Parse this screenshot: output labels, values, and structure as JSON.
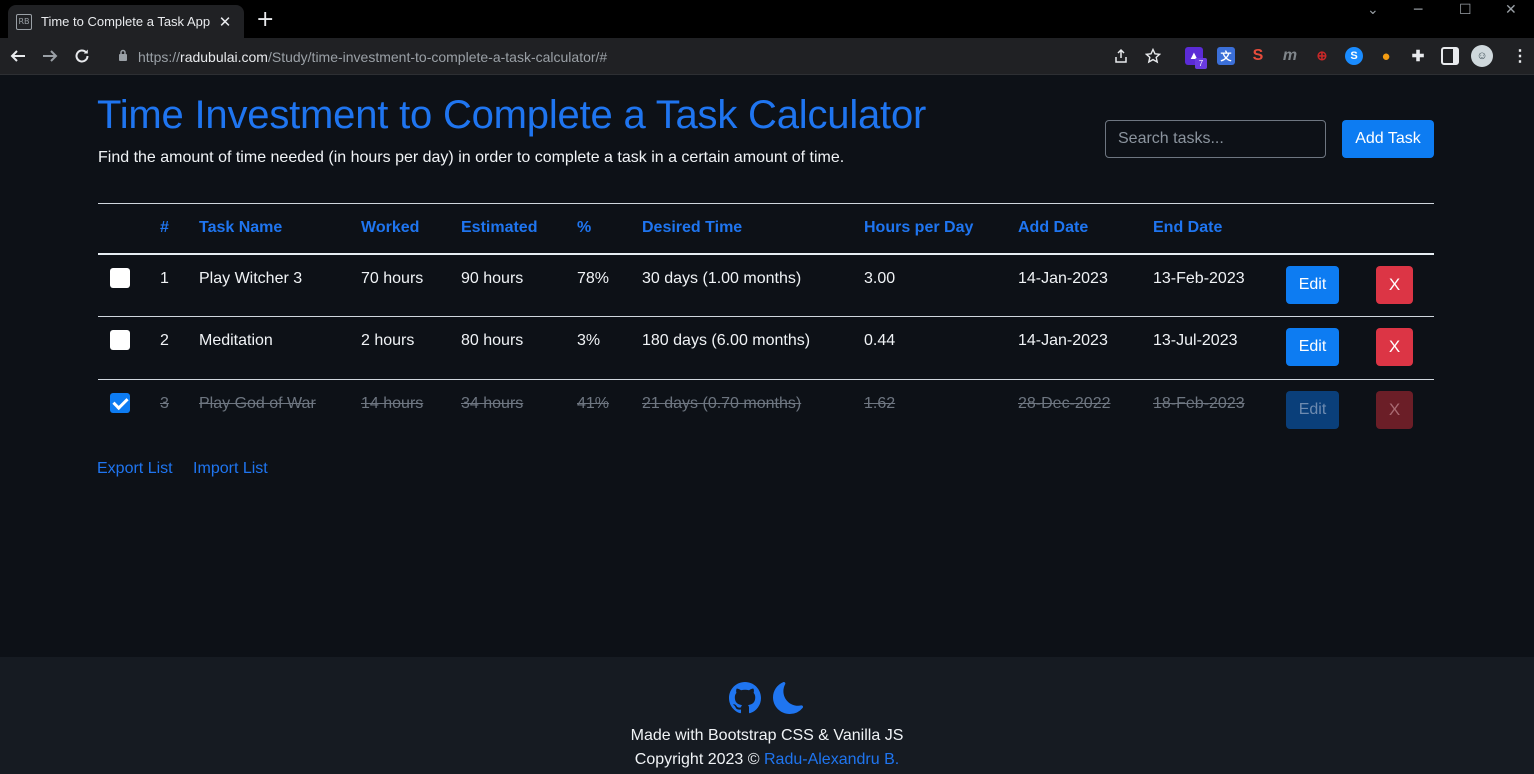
{
  "browser": {
    "tab_title": "Time to Complete a Task App",
    "tab_favicon": "RB",
    "url_prefix": "https://",
    "url_host": "radubulai.com",
    "url_path": "/Study/time-investment-to-complete-a-task-calculator/#",
    "extensions": [
      {
        "icon": "graduation-cap-icon",
        "color": "#5b2bd6",
        "badge": "7"
      },
      {
        "icon": "translate-icon",
        "color": "#3b6fd8"
      },
      {
        "icon": "s-icon",
        "color": "#c0392b"
      },
      {
        "icon": "m-icon",
        "color": "#5f6368"
      },
      {
        "icon": "analytics-icon",
        "color": "#b71c1c"
      },
      {
        "icon": "shazam-icon",
        "color": "#1a8cff"
      },
      {
        "icon": "honey-icon",
        "color": "#f39c12"
      }
    ]
  },
  "header": {
    "title": "Time Investment to Complete a Task Calculator",
    "subtitle": "Find the amount of time needed (in hours per day) in order to complete a task in a certain amount of time."
  },
  "search": {
    "placeholder": "Search tasks..."
  },
  "add_task_label": "Add Task",
  "table": {
    "headers": [
      "#",
      "Task Name",
      "Worked",
      "Estimated",
      "%",
      "Desired Time",
      "Hours per Day",
      "Add Date",
      "End Date"
    ],
    "edit_label": "Edit",
    "delete_label": "X",
    "rows": [
      {
        "num": "1",
        "name": "Play Witcher 3",
        "worked": "70 hours",
        "estimated": "90 hours",
        "percent": "78%",
        "desired": "30 days (1.00 months)",
        "hpd": "3.00",
        "add_date": "14-Jan-2023",
        "end_date": "13-Feb-2023",
        "done": false
      },
      {
        "num": "2",
        "name": "Meditation",
        "worked": "2 hours",
        "estimated": "80 hours",
        "percent": "3%",
        "desired": "180 days (6.00 months)",
        "hpd": "0.44",
        "add_date": "14-Jan-2023",
        "end_date": "13-Jul-2023",
        "done": false
      },
      {
        "num": "3",
        "name": "Play God of War",
        "worked": "14 hours",
        "estimated": "34 hours",
        "percent": "41%",
        "desired": "21 days (0.70 months)",
        "hpd": "1.62",
        "add_date": "28-Dec-2022",
        "end_date": "18-Feb-2023",
        "done": true
      }
    ]
  },
  "links": {
    "export": "Export List",
    "import": "Import List"
  },
  "footer": {
    "made_with": "Made with Bootstrap CSS & Vanilla JS",
    "copyright": "Copyright 2023 © ",
    "author": "Radu-Alexandru B."
  }
}
